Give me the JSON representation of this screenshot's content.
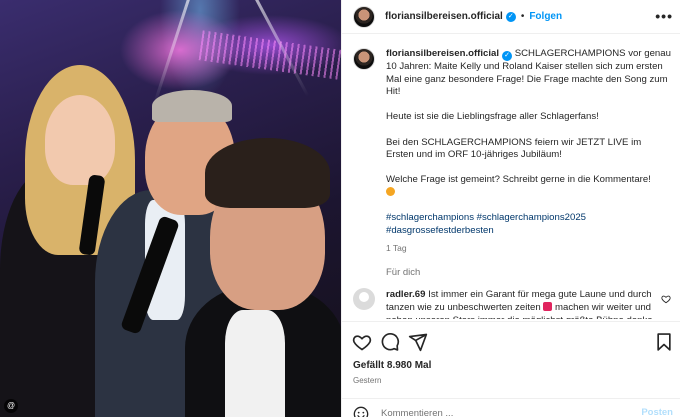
{
  "post": {
    "username": "floriansilbereisen.official",
    "follow_label": "Folgen",
    "dot": "•",
    "more_label": "•••",
    "image_badge": "@"
  },
  "caption": {
    "username": "floriansilbereisen.official",
    "intro": "SCHLAGERCHAMPIONS vor genau 10 Jahren: Maite Kelly und Roland Kaiser stellen sich zum ersten Mal eine ganz besondere Frage! Die Frage machte den Song zum Hit!",
    "p2": "Heute ist sie die Lieblingsfrage aller Schlagerfans!",
    "p3": "Bei den SCHLAGERCHAMPIONS feiern wir JETZT LIVE im Ersten und im ORF 10-jähriges Jubiläum!",
    "p4": "Welche Frage ist gemeint? Schreibt gerne in die Kommentare!",
    "hashtags": "#schlagerchampions #schlagerchampions2025 #dasgrossefestderbesten",
    "age": "1 Tag"
  },
  "for_you": "Für dich",
  "comment": {
    "username": "radler.69",
    "text": "Ist immer ein Garant für mega gute Laune und durch tanzen wie zu unbeschwerten zeiten",
    "text_cont": "machen wir weiter und neben unseren Stars immer die möglichst größte Bühne danke"
  },
  "actions": {
    "likes": "Gefällt 8.980 Mal",
    "date": "Gestern"
  },
  "add_comment": {
    "placeholder": "Kommentieren ...",
    "post_label": "Posten"
  },
  "icons": [
    "heart-icon",
    "comment-icon",
    "share-icon",
    "bookmark-icon",
    "smiley-icon",
    "verified-icon",
    "more-icon"
  ],
  "colors": {
    "accent": "#0095f6",
    "hashtag": "#00376b",
    "muted": "#737373"
  }
}
